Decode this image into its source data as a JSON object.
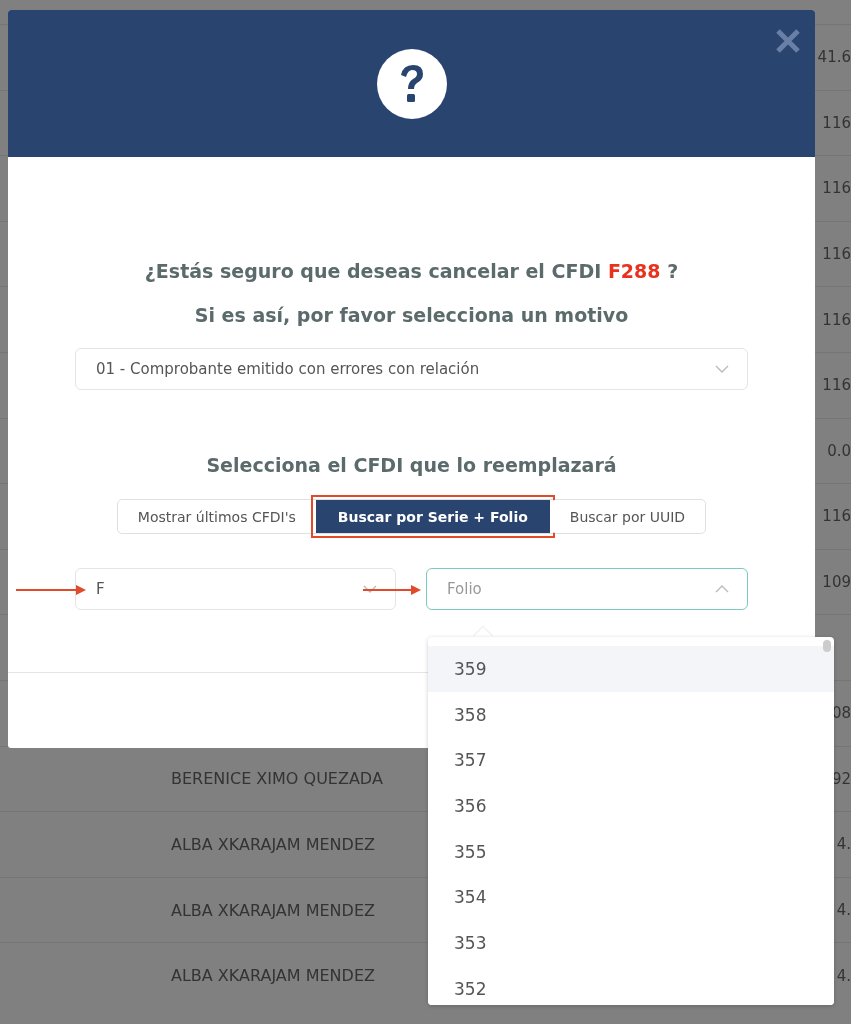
{
  "background_table": {
    "rows": [
      {
        "name": "",
        "value": "41.6"
      },
      {
        "name": "",
        "value": "116"
      },
      {
        "name": "",
        "value": "116"
      },
      {
        "name": "",
        "value": "116"
      },
      {
        "name": "",
        "value": "116"
      },
      {
        "name": "",
        "value": "116"
      },
      {
        "name": "",
        "value": "0.0"
      },
      {
        "name": "",
        "value": "116"
      },
      {
        "name": "",
        "value": "109"
      },
      {
        "name": "",
        "value": ""
      },
      {
        "name": "",
        "value": "08"
      },
      {
        "name": "BERENICE XIMO QUEZADA",
        "value": "92"
      },
      {
        "name": "ALBA XKARAJAM MENDEZ",
        "value": "4."
      },
      {
        "name": "ALBA XKARAJAM MENDEZ",
        "value": "4."
      },
      {
        "name": "ALBA XKARAJAM MENDEZ",
        "value": "4."
      }
    ]
  },
  "dialog": {
    "title_before": "¿Estás seguro que deseas cancelar el CFDI",
    "cfdi": "F288",
    "title_after": "?",
    "subtitle": "Si es así, por favor selecciona un motivo",
    "reason_select": {
      "value": "01 - Comprobante emitido con errores con relación",
      "expanded": false
    },
    "replace_title": "Selecciona el CFDI que lo reemplazará",
    "tabs": [
      {
        "label": "Mostrar últimos CFDI's",
        "selected": false,
        "highlighted": false
      },
      {
        "label": "Buscar por Serie + Folio",
        "selected": true,
        "highlighted": true
      },
      {
        "label": "Buscar por UUID",
        "selected": false,
        "highlighted": false
      }
    ],
    "serie_select": {
      "value": "F",
      "expanded": false,
      "annotated": true
    },
    "folio_select": {
      "placeholder": "Folio",
      "expanded": true,
      "annotated": true,
      "options": [
        {
          "label": "359",
          "selected": true
        },
        {
          "label": "358",
          "selected": false
        },
        {
          "label": "357",
          "selected": false
        },
        {
          "label": "356",
          "selected": false
        },
        {
          "label": "355",
          "selected": false
        },
        {
          "label": "354",
          "selected": false
        },
        {
          "label": "353",
          "selected": false
        },
        {
          "label": "352",
          "selected": false
        }
      ]
    }
  }
}
